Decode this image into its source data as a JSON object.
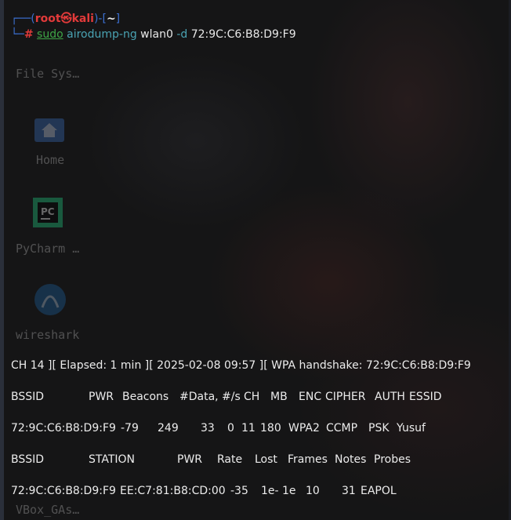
{
  "desktop_icons": [
    {
      "name": "file-system",
      "label": "File Sys…"
    },
    {
      "name": "home",
      "label": "Home"
    },
    {
      "name": "pycharm",
      "label": "PyCharm …"
    },
    {
      "name": "wireshark",
      "label": "wireshark"
    },
    {
      "name": "vbox",
      "label": "VBox_GAs…"
    }
  ],
  "prompt": {
    "user": "root",
    "skull": "㉿",
    "host": "kali",
    "path": "~",
    "symbol": "#",
    "cmd_sudo": "sudo",
    "cmd_prog": "airodump-ng",
    "cmd_iface": "wlan0",
    "cmd_flag": "-d",
    "cmd_target": "72:9C:C6:B8:D9:F9"
  },
  "status_line": "CH 14 ][ Elapsed: 1 min ][ 2025-02-08 09:57 ][ WPA handshake: 72:9C:C6:B8:D9:F9",
  "ap_header": {
    "bssid": "BSSID",
    "pwr": "PWR",
    "beacons": "Beacons",
    "data": "#Data, #/s",
    "ch": "CH",
    "mb": "MB",
    "enc": "ENC",
    "cipher": "CIPHER",
    "auth": "AUTH",
    "essid": "ESSID"
  },
  "ap_row": {
    "bssid": "72:9C:C6:B8:D9:F9",
    "pwr": "-79",
    "beacons": "249",
    "data": "33",
    "rate": "0",
    "ch": "11",
    "mb": "180",
    "enc": "WPA2",
    "cipher": "CCMP",
    "auth": "PSK",
    "essid": "Yusuf"
  },
  "sta_header": {
    "bssid": "BSSID",
    "station": "STATION",
    "pwr": "PWR",
    "rate": "Rate",
    "lost": "Lost",
    "frames": "Frames",
    "notes": "Notes",
    "probes": "Probes"
  },
  "sta_row": {
    "bssid": "72:9C:C6:B8:D9:F9",
    "station": "EE:C7:81:B8:CD:00",
    "pwr": "-35",
    "rate": "1e- 1e",
    "lost": "10",
    "frames": "31",
    "notes": "EAPOL"
  }
}
